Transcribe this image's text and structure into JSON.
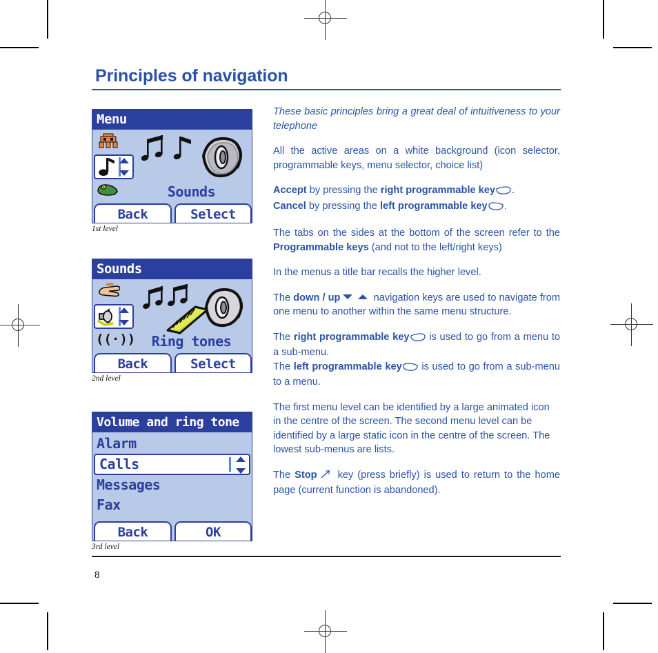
{
  "page": {
    "title": "Principles of navigation",
    "number": "8"
  },
  "body_text": {
    "intro": "These basic principles bring a great deal of intuitiveness to your telephone",
    "active_areas": "All the active areas on a white background (icon selector, programmable keys, menu selector, choice list)",
    "accept_bold": "Accept",
    "accept_mid": " by pressing the ",
    "accept_key": "right programmable key",
    "cancel_bold": "Cancel",
    "cancel_mid": " by pressing the ",
    "cancel_key": "left programmable key",
    "tabs_line_a": "The tabs on the sides at the bottom of the screen refer to the ",
    "tabs_line_b": "Programmable keys",
    "tabs_line_c": " (and not to the left/right keys)",
    "title_bar": "In the menus a title bar recalls the higher level.",
    "nav_a": "The ",
    "nav_b": "down / up",
    "nav_c": " navigation keys are used to navigate from one menu to another within the same menu structure.",
    "right_key_a": "The ",
    "right_key_b": "right programmable key",
    "right_key_c": " is used to go from a menu to a sub-menu.",
    "left_key_a": "The ",
    "left_key_b": "left programmable key",
    "left_key_c": " is used to go from a sub-menu to a menu.",
    "levels": "The first menu level can be identified by a large animated icon in the centre of the screen. The second menu level can be identified by a large static icon in the centre of the screen. The lowest sub-menus are lists.",
    "levels_1": "The first menu level can be identified by a large animated icon in the centre of the screen.",
    "levels_2": "The second menu level can be identified by a large static icon in the centre of the screen.",
    "levels_3": "The lowest sub-menus are lists.",
    "stop_a": "The ",
    "stop_b": "Stop",
    "stop_c": " key (press briefly) is used to return to the home page (current function is abandoned)."
  },
  "screens": [
    {
      "title": "Menu",
      "center_label": "Sounds",
      "caption": "1st level",
      "tab_left": "Back",
      "tab_right": "Select",
      "icons": [
        "games-icon",
        "music-note-icon",
        "frog-icon"
      ],
      "big_icon": "speaker-with-notes-icon"
    },
    {
      "title": "Sounds",
      "center_label": "Ring tones",
      "caption": "2nd level",
      "tab_left": "Back",
      "tab_right": "Select",
      "icons": [
        "hand-pointer-icon",
        "speaker-volume-icon",
        "ringing-icon"
      ],
      "big_icon": "speaker-with-keyboard-icon"
    },
    {
      "title": "Volume and ring tone",
      "caption": "3rd level",
      "tab_left": "Back",
      "tab_right": "OK",
      "list": [
        "Alarm",
        "Calls",
        "Messages",
        "Fax"
      ],
      "selected_index": 1
    }
  ],
  "colors": {
    "brand_blue": "#2a52a5",
    "screen_title_bar": "#2b3f9e",
    "screen_background": "#b9c9e8",
    "text_black": "#111111"
  }
}
